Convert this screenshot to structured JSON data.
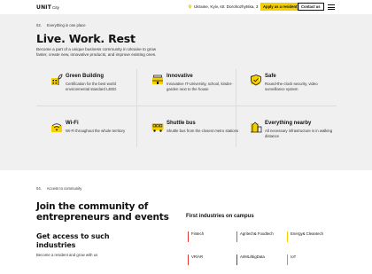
{
  "header": {
    "logo_mark": "UNIT",
    "logo_city": "City",
    "address": "Ukraine, Kyiv, str. Dorohozhytska, 3",
    "apply_label": "Apply as a resident",
    "contact_label": "Contact us",
    "accent": "#f5d000"
  },
  "hero": {
    "section_num": "02.",
    "section_label": "Everything in one place",
    "title": "Live. Work. Rest",
    "intro": "Become a part of a unique business community in Ukraine to grow faster, create new, innovative products, and improve existing ones."
  },
  "features": [
    {
      "title": "Green Building",
      "desc": "Certification for the best world environmental standard LEED",
      "icon": "green-building-icon"
    },
    {
      "title": "Innovative",
      "desc": "Innovative IT-University, school, kinder-garden next to the house",
      "icon": "innovative-icon"
    },
    {
      "title": "Safe",
      "desc": "Round-the-clock security, video surveillance system",
      "icon": "shield-icon"
    },
    {
      "title": "Wi-Fi",
      "desc": "Wi-Fi throughout the whole territory",
      "icon": "wifi-icon"
    },
    {
      "title": "Shuttle bus",
      "desc": "Shuttle bus from the closest metro stations",
      "icon": "bus-icon"
    },
    {
      "title": "Everything nearby",
      "desc": "All necessary infrastructure is in walking distance",
      "icon": "nearby-icon"
    }
  ],
  "community": {
    "section_num": "04.",
    "section_label": "Access to community",
    "title": "Join the community of entrepreneurs and events",
    "access_title": "Get access to such industries",
    "access_sub": "Become a resident and grow with us",
    "industries_title": "First industries on campus",
    "industries": [
      {
        "name": "Fintech",
        "color": "#e53935"
      },
      {
        "name": "Agritech& Foodtech",
        "color": "#43a047"
      },
      {
        "name": "Energy& Cleantech",
        "color": "#f5d000"
      },
      {
        "name": "VR/AR",
        "color": "#e53935"
      },
      {
        "name": "AI/ML/BigData",
        "color": "#3949ab"
      },
      {
        "name": "IoT",
        "color": "#9e9e9e"
      }
    ]
  }
}
